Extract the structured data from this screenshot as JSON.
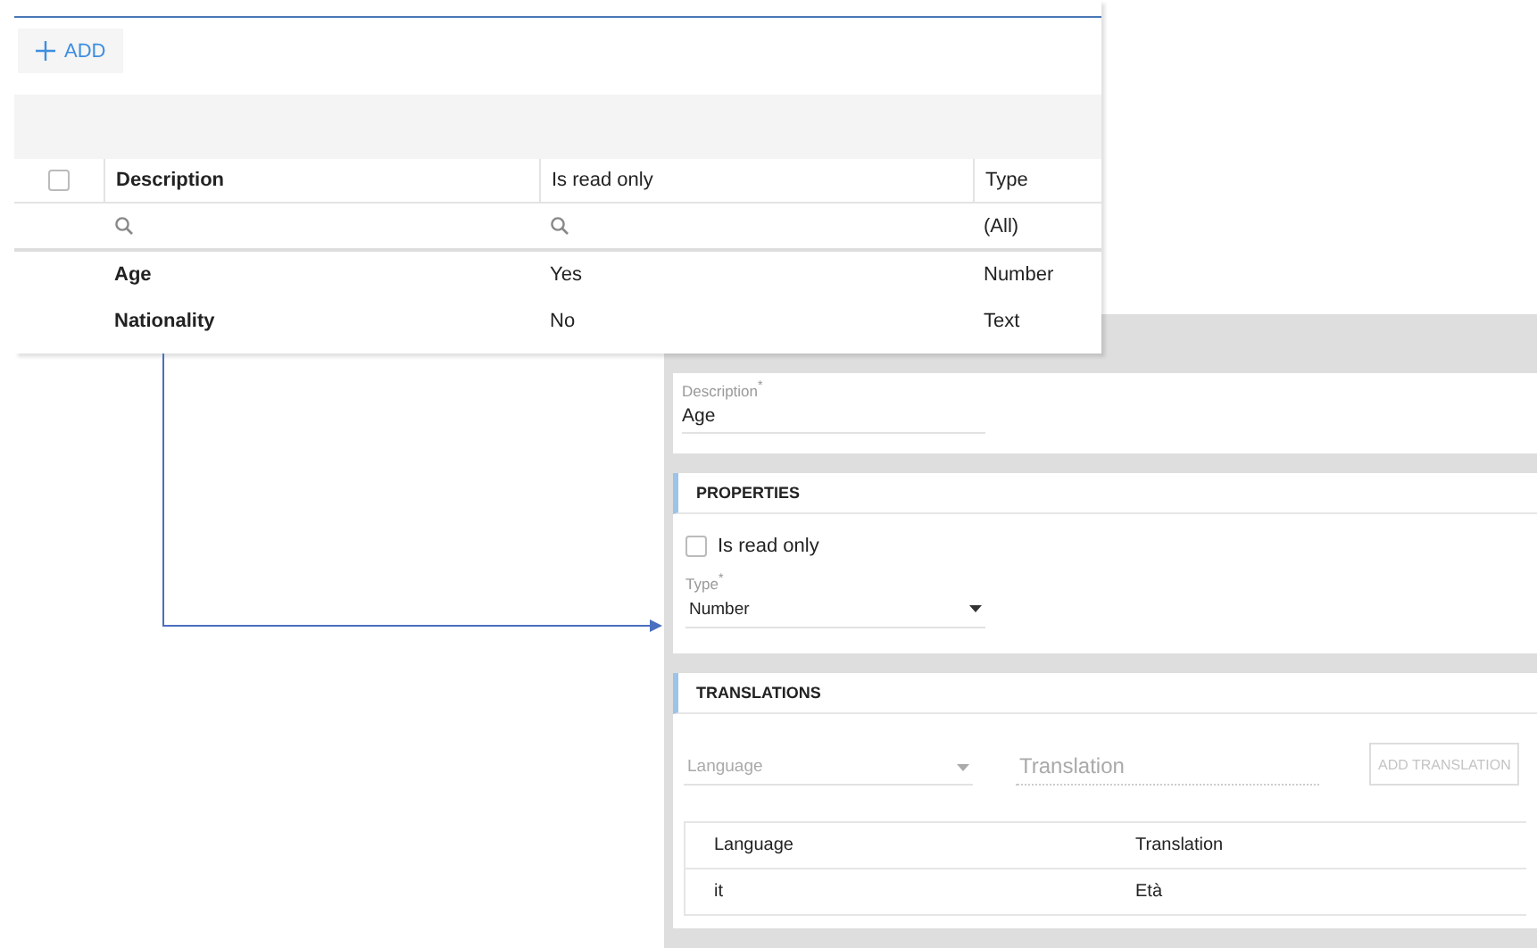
{
  "toolbar": {
    "add_button": {
      "label": "ADD"
    }
  },
  "grid": {
    "select_all": {
      "checked": false
    },
    "columns": [
      {
        "label": "Description"
      },
      {
        "label": "Is read only"
      },
      {
        "label": "Type"
      }
    ],
    "filters": [
      {
        "kind": "search"
      },
      {
        "kind": "search"
      },
      {
        "kind": "text",
        "value": "(All)"
      }
    ],
    "rows": [
      {
        "cells": [
          "Age",
          "Yes",
          "Number"
        ]
      },
      {
        "cells": [
          "Nationality",
          "No",
          "Text"
        ]
      }
    ]
  },
  "detail": {
    "description": {
      "label": "Description$^{*}$",
      "value": "Age"
    },
    "properties": {
      "title": "PROPERTIES",
      "read_only": {
        "label": "Is read only",
        "checked": false
      },
      "type": {
        "label": "Type$^{*}$",
        "value": "Number"
      }
    },
    "translations": {
      "title": "TRANSLATIONS",
      "language": {
        "placeholder": "Language"
      },
      "translation": {
        "placeholder": "Translation"
      },
      "add_button": {
        "label": "ADD TRANSLATION",
        "disabled": true
      },
      "columns": [
        "Language",
        "Translation"
      ],
      "rows": [
        [
          "it",
          "Età"
        ]
      ]
    }
  }
}
